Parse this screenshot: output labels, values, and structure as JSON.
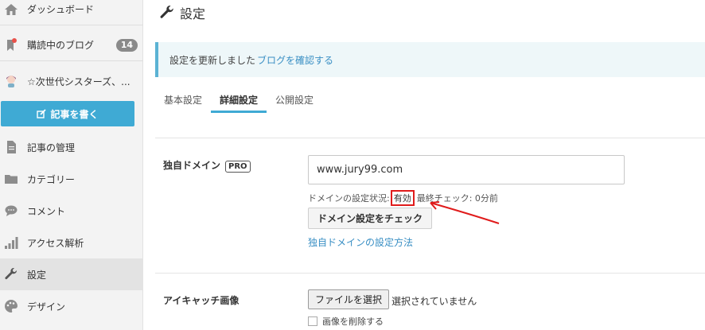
{
  "sidebar": {
    "items": [
      {
        "label": "ダッシュボード",
        "icon": "home-icon"
      },
      {
        "label": "購読中のブログ",
        "icon": "bookmark-icon",
        "badge": "14"
      },
      {
        "label": "☆次世代シスターズ、...",
        "icon": "blog-avatar-icon"
      },
      {
        "label": "記事の管理",
        "icon": "document-icon"
      },
      {
        "label": "カテゴリー",
        "icon": "folder-icon"
      },
      {
        "label": "コメント",
        "icon": "comment-icon"
      },
      {
        "label": "アクセス解析",
        "icon": "bar-chart-icon"
      },
      {
        "label": "設定",
        "icon": "wrench-icon"
      },
      {
        "label": "デザイン",
        "icon": "palette-icon"
      }
    ],
    "write_button": "記事を書く"
  },
  "header": {
    "title": "設定"
  },
  "notice": {
    "text": "設定を更新しました",
    "link": "ブログを確認する"
  },
  "tabs": [
    {
      "label": "基本設定"
    },
    {
      "label": "詳細設定"
    },
    {
      "label": "公開設定"
    }
  ],
  "domain": {
    "label": "独自ドメイン",
    "badge": "PRO",
    "value": "www.jury99.com",
    "status_prefix": "ドメインの設定状況:",
    "status_value": "有効",
    "last_check": "最終チェック: 0分前",
    "check_button": "ドメイン設定をチェック",
    "howto_link": "独自ドメインの設定方法"
  },
  "eyecatch": {
    "label": "アイキャッチ画像",
    "file_button": "ファイルを選択",
    "file_status": "選択されていません",
    "delete_label": "画像を削除する"
  },
  "colors": {
    "accent": "#3faad4",
    "link": "#3a8fc4",
    "highlight": "#e01b1b"
  }
}
